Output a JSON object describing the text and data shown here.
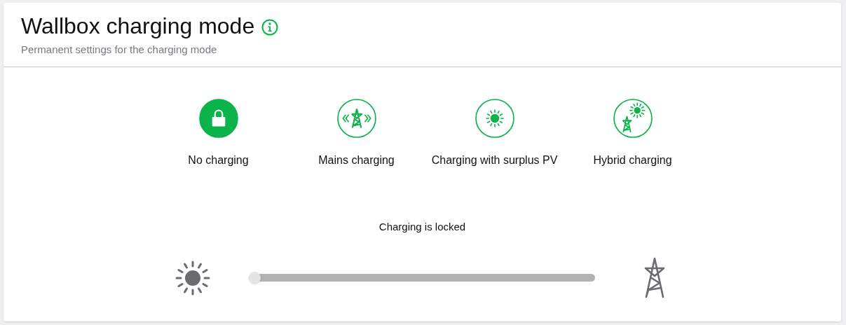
{
  "header": {
    "title": "Wallbox charging mode",
    "subtitle": "Permanent settings for the charging mode"
  },
  "modes": [
    {
      "kind": "lock",
      "label": "No charging",
      "selected": true
    },
    {
      "kind": "mains",
      "label": "Mains charging",
      "selected": false
    },
    {
      "kind": "pv",
      "label": "Charging with surplus PV",
      "selected": false
    },
    {
      "kind": "hybrid",
      "label": "Hybrid charging",
      "selected": false
    }
  ],
  "slider": {
    "caption": "Charging is locked",
    "level": 0
  }
}
